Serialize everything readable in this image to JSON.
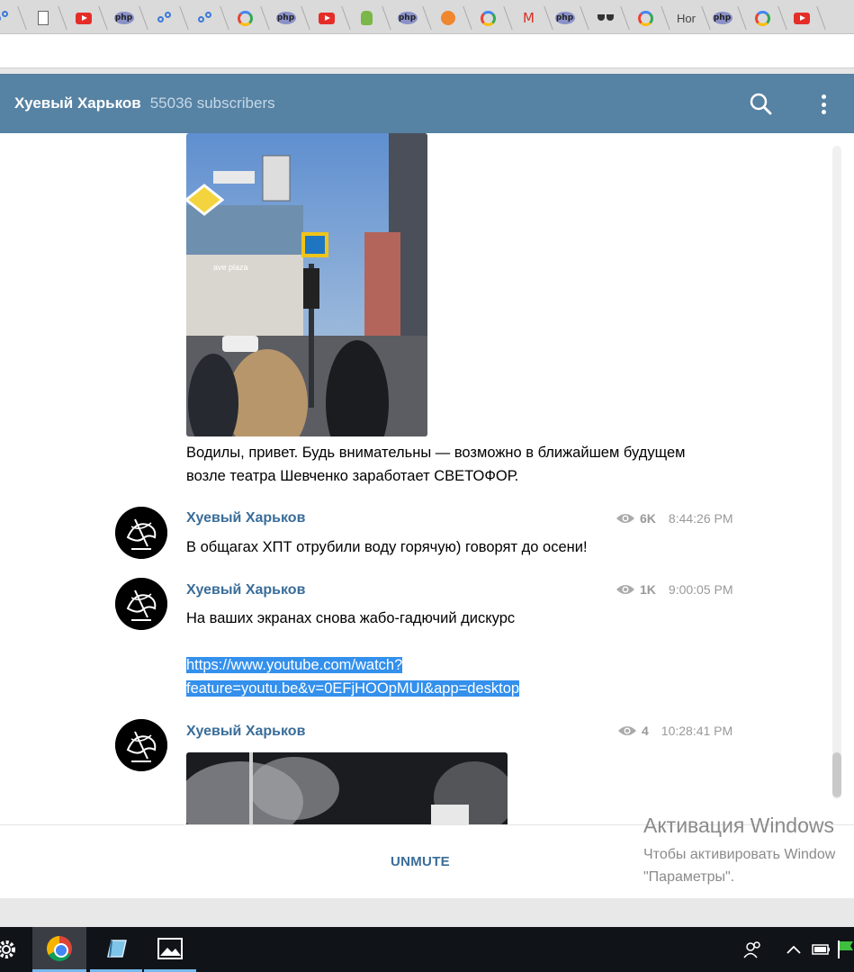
{
  "browser": {
    "tabs": [
      {
        "icon": "tab-dots-icon"
      },
      {
        "icon": "tab-document-icon"
      },
      {
        "icon": "tab-youtube-icon"
      },
      {
        "icon": "tab-php-icon",
        "label": "php"
      },
      {
        "icon": "tab-dots-icon"
      },
      {
        "icon": "tab-dots-icon"
      },
      {
        "icon": "tab-google-icon"
      },
      {
        "icon": "tab-php-icon",
        "label": "php"
      },
      {
        "icon": "tab-youtube-icon"
      },
      {
        "icon": "tab-android-icon"
      },
      {
        "icon": "tab-php-icon",
        "label": "php"
      },
      {
        "icon": "tab-orange-icon"
      },
      {
        "icon": "tab-google-icon"
      },
      {
        "icon": "tab-gmail-icon",
        "label": "M"
      },
      {
        "icon": "tab-php-icon",
        "label": "php"
      },
      {
        "icon": "tab-glasses-icon"
      },
      {
        "icon": "tab-google-icon"
      },
      {
        "icon": "tab-text",
        "label": "Hor"
      },
      {
        "icon": "tab-php-icon",
        "label": "php"
      },
      {
        "icon": "tab-google-icon"
      },
      {
        "icon": "tab-youtube-icon"
      }
    ]
  },
  "channel": {
    "title": "Хуевый Харьков",
    "subscribers": "55036 subscribers"
  },
  "messages": [
    {
      "text": "Водилы, привет. Будь внимательны — возможно в ближайшем будущем возле театра Шевченко заработает СВЕТОФОР."
    },
    {
      "author": "Хуевый Харьков",
      "views": "6K",
      "time": "8:44:26 PM",
      "text": "В общагах ХПТ отрубили воду горячую) говорят до осени!"
    },
    {
      "author": "Хуевый Харьков",
      "views": "1K",
      "time": "9:00:05 PM",
      "text": "На ваших экранах снова жабо-гадючий дискурс",
      "link_line1": "https://www.youtube.com/watch?",
      "link_line2": "feature=youtu.be&v=0EFjHOOpMUI&app=desktop"
    },
    {
      "author": "Хуевый Харьков",
      "views": "4",
      "time": "10:28:41 PM"
    }
  ],
  "composer": {
    "unmute_label": "UNMUTE"
  },
  "windows_activation": {
    "title": "Активация Windows",
    "line1": "Чтобы активировать Window",
    "line2": "\"Параметры\"."
  },
  "photo_sign_text": "ave plaza",
  "colors": {
    "header": "#5682a3",
    "author": "#3a6d99",
    "link_highlight": "#3390ec"
  }
}
